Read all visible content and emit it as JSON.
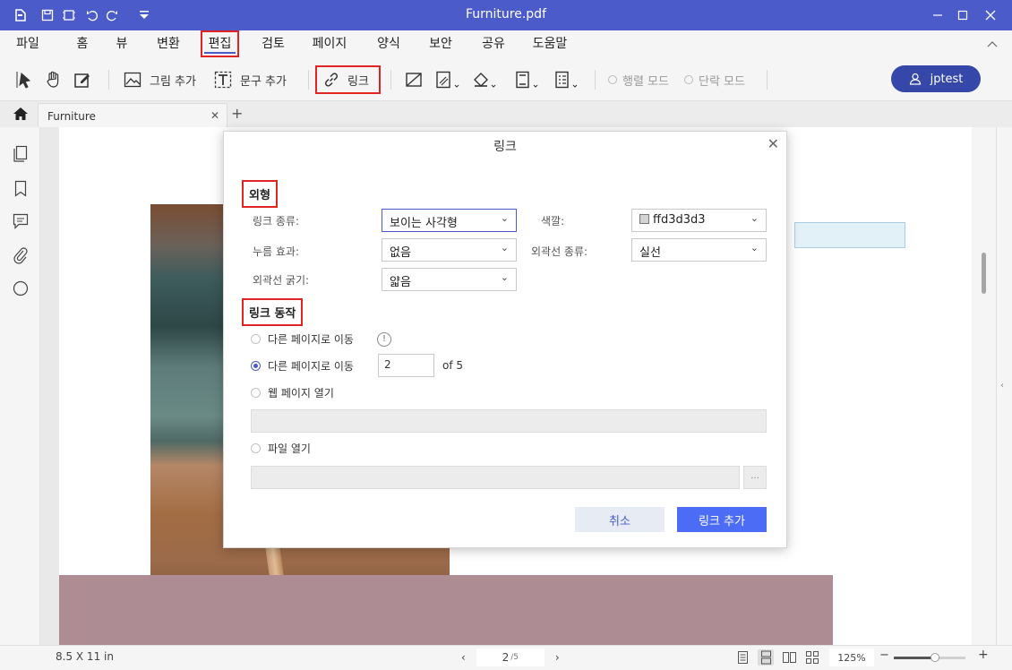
{
  "titlebar": {
    "title": "Furniture.pdf"
  },
  "menu": {
    "items": [
      "파일",
      "홈",
      "뷰",
      "변환",
      "편집",
      "검토",
      "페이지",
      "양식",
      "보안",
      "공유",
      "도움말"
    ],
    "active_index": 4
  },
  "toolbar": {
    "add_image": "그림 추가",
    "add_text": "문구 추가",
    "link": "링크",
    "row_mode": "행렬 모드",
    "paragraph_mode": "단락 모드",
    "user": "jptest"
  },
  "tabs": {
    "doc_tab": "Furniture"
  },
  "dialog": {
    "title": "링크",
    "appearance_section": "외형",
    "link_type_label": "링크 종류:",
    "link_type_value": "보이는 사각형",
    "color_label": "색깔:",
    "color_value": "ffd3d3d3",
    "highlight_label": "누름 효과:",
    "highlight_value": "없음",
    "border_style_label": "외곽선 종류:",
    "border_style_value": "실선",
    "border_width_label": "외곽선 굵기:",
    "border_width_value": "얇음",
    "action_section": "링크 동작",
    "option1": "다른 페이지로 이동",
    "option2": "다른 페이지로 이동",
    "page_value": "2",
    "page_of": "of 5",
    "option3": "웹 페이지 열기",
    "option4": "파일 열기",
    "browse": "...",
    "cancel": "취소",
    "add": "링크 추가"
  },
  "statusbar": {
    "page_size": "8.5 X 11 in",
    "current_page": "2",
    "total_pages": "/5",
    "zoom": "125%",
    "zoom_fraction": 0.58
  },
  "colors": {
    "titlebar": "#4b5bc9",
    "primary": "#4c6cf5",
    "highlight": "#e02424",
    "swatch": "#d3d3d3"
  }
}
